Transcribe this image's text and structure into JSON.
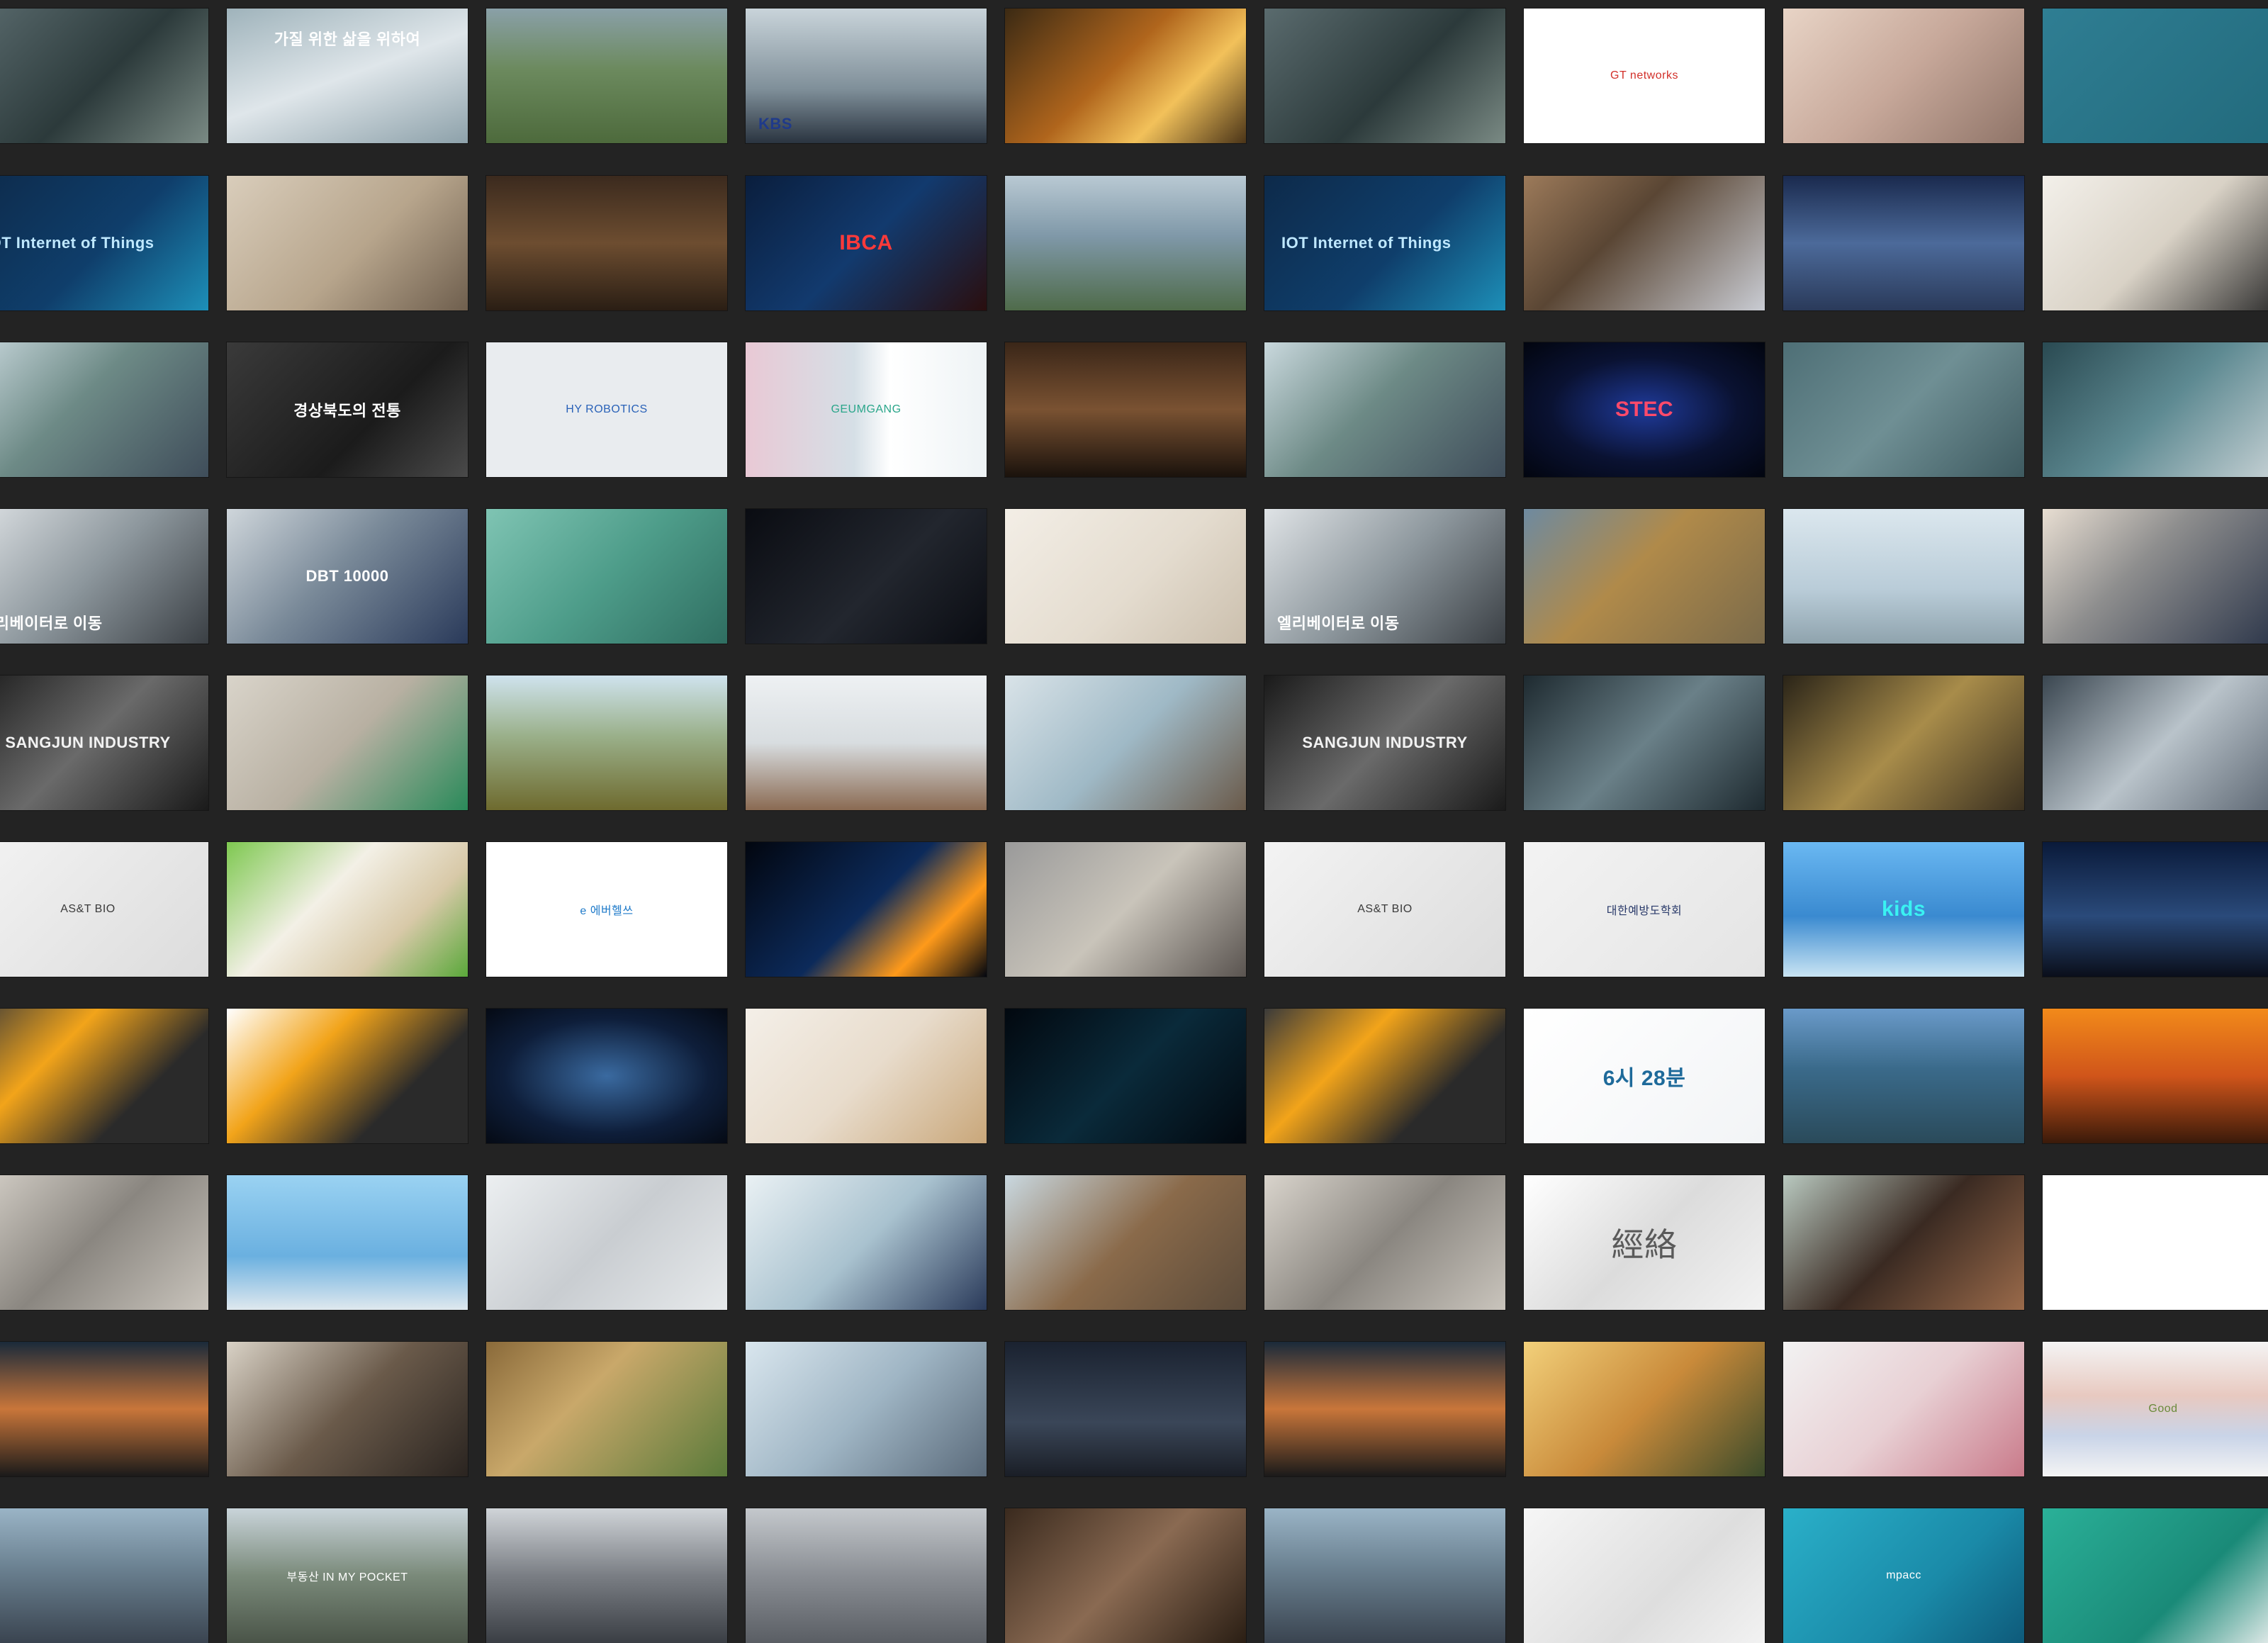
{
  "tiles": [
    {
      "bg": "linear-gradient(135deg,#5a6b6e,#2c3a3b 55%,#7a8a84)"
    },
    {
      "bg": "linear-gradient(160deg,#9fb3bb,#dfe6ea 50%,#8da1aa)",
      "caption": "가질 위한 삶을 위하여",
      "captionColor": "#ffffff",
      "style": "upper"
    },
    {
      "bg": "linear-gradient(180deg,#8aa0a8 0%,#6c8a5e 45%,#4d6a3c 100%)"
    },
    {
      "bg": "linear-gradient(180deg,#c9d4da,#7f8f99 60%,#2a3440)",
      "caption": "KBS",
      "captionColor": "#1f3a8a",
      "style": "lowerband"
    },
    {
      "bg": "linear-gradient(135deg,#3b2a14,#b0651c 45%,#f2c15a 70%,#4a3418)"
    },
    {
      "bg": "linear-gradient(135deg,#5a6b6e,#2c3a3b 55%,#7a8a84)"
    },
    {
      "bg": "#ffffff",
      "caption": "GT networks",
      "captionColor": "#d2302a",
      "style": "small"
    },
    {
      "bg": "linear-gradient(135deg,#e8d4c6,#c7a89a 50%,#8f7468)"
    },
    {
      "bg": "linear-gradient(135deg,#2f7e93,#226a7c)",
      "caption": "",
      "captionColor": "#ffffff"
    },
    {
      "bg": "linear-gradient(135deg,#0d2a4a,#0f3e6b 55%,#1d8fb8)",
      "caption": "IOT Internet of Things",
      "captionColor": "#bfe8ff",
      "style": "left"
    },
    {
      "bg": "linear-gradient(135deg,#d9cdbb,#b7a58c 55%,#6f5f4e)"
    },
    {
      "bg": "linear-gradient(180deg,#3b2a1e,#6d4d30 50%,#2a1e14)"
    },
    {
      "bg": "linear-gradient(135deg,#0a1e3d,#123a6e 50%,#2a0e0e)",
      "caption": "IBCA",
      "captionColor": "#ff3a3a",
      "style": "big"
    },
    {
      "bg": "linear-gradient(180deg,#b9c9d3,#7f98a8 45%,#4f6b4a)"
    },
    {
      "bg": "linear-gradient(135deg,#0d2a4a,#0f3e6b 55%,#1d8fb8)",
      "caption": "IOT Internet of Things",
      "captionColor": "#bfe8ff",
      "style": "left"
    },
    {
      "bg": "linear-gradient(135deg,#9c7a5a,#5a4634 40%,#c9ccd3)"
    },
    {
      "bg": "linear-gradient(180deg,#1a2a4e,#4c6a9a 50%,#2a3a5a)"
    },
    {
      "bg": "linear-gradient(135deg,#f3f0ea,#d9d2c6 50%,#2a2a2a)"
    },
    {
      "bg": "linear-gradient(135deg,#c9d8dd,#6d8a86 45%,#3f4d5a)"
    },
    {
      "bg": "linear-gradient(135deg,#3a3a3a,#1b1b1b 60%,#4a4a4a)",
      "caption": "경상북도의 전통",
      "captionColor": "#ffffff"
    },
    {
      "bg": "#e9ecef",
      "caption": "HY ROBOTICS",
      "captionColor": "#2a62b8",
      "style": "small"
    },
    {
      "bg": "linear-gradient(90deg,#e9c9d5 0%,#d5dfe6 45%,#ffffff 60%,#eef3f5 100%)",
      "caption": "GEUMGANG",
      "captionColor": "#2aa68a",
      "style": "small"
    },
    {
      "bg": "linear-gradient(180deg,#3a2618,#7a5232 50%,#1a120c)"
    },
    {
      "bg": "linear-gradient(135deg,#c9d8dd,#6d8a86 45%,#3f4d5a)"
    },
    {
      "bg": "radial-gradient(ellipse at center,#1f3a9a 0%,#0a1232 55%,#02050f 100%)",
      "caption": "STEC",
      "captionColor": "#ff4a6a",
      "style": "big"
    },
    {
      "bg": "linear-gradient(135deg,#4e6f76,#6f8f94 50%,#3e5a60)"
    },
    {
      "bg": "linear-gradient(135deg,#2a4a52,#5e8a92 50%,#c9d3d6)"
    },
    {
      "bg": "linear-gradient(135deg,#dfe3e6,#8d979d 50%,#3a3f44)",
      "caption": "엘리베이터로 이동",
      "captionColor": "#ffffff",
      "style": "lowerband"
    },
    {
      "bg": "linear-gradient(135deg,#cfd6db,#7a8a99 45%,#2a3a5a)",
      "caption": "DBT 10000",
      "captionColor": "#ffffff"
    },
    {
      "bg": "linear-gradient(135deg,#7fc4b3,#4e9d8a 50%,#2f6e61)"
    },
    {
      "bg": "linear-gradient(135deg,#0a0c12,#22262e 55%,#0a0c12)"
    },
    {
      "bg": "linear-gradient(135deg,#f3eee6,#e4dccf 55%,#cbbfad)"
    },
    {
      "bg": "linear-gradient(135deg,#dfe3e6,#8d979d 50%,#3a3f44)",
      "caption": "엘리베이터로 이동",
      "captionColor": "#ffffff",
      "style": "lowerband"
    },
    {
      "bg": "linear-gradient(135deg,#6e8aa0,#b08a4a 45%,#7a6a4a)"
    },
    {
      "bg": "linear-gradient(180deg,#dbe7ee,#b9ccd8 60%,#8fa3ad)"
    },
    {
      "bg": "linear-gradient(135deg,#e8ded2,#8e8e8e 40%,#2a3448)"
    },
    {
      "bg": "linear-gradient(135deg,#1a1a1a,#6a6a6a 50%,#1a1a1a)",
      "caption": "SANGJUN INDUSTRY",
      "captionColor": "#f2f2f2"
    },
    {
      "bg": "linear-gradient(135deg,#d9d4ca,#b8b0a2 50%,#2a8a5a)"
    },
    {
      "bg": "linear-gradient(180deg,#cfe3ee,#9ab08a 45%,#6e6a2e)"
    },
    {
      "bg": "linear-gradient(180deg,#eef1f3,#d8dde0 50%,#8a6a52)"
    },
    {
      "bg": "linear-gradient(135deg,#d9e3e8,#9fb9c6 50%,#6a5a4a)"
    },
    {
      "bg": "linear-gradient(135deg,#1a1a1a,#6a6a6a 50%,#1a1a1a)",
      "caption": "SANGJUN INDUSTRY",
      "captionColor": "#f2f2f2"
    },
    {
      "bg": "linear-gradient(135deg,#1e2a30,#6a8088 50%,#1e2a30)"
    },
    {
      "bg": "linear-gradient(135deg,#2a2418,#a88c4a 50%,#3a3020)"
    },
    {
      "bg": "linear-gradient(135deg,#3a4650,#b9c3ca 50%,#5a6470)"
    },
    {
      "bg": "linear-gradient(135deg,#f3f3f3,#dcdcdc)",
      "caption": "AS&T BIO",
      "captionColor": "#3a3a3a",
      "style": "small"
    },
    {
      "bg": "linear-gradient(135deg,#7ec850,#f3f0e6 40%,#d8c9a8 70%,#5aa83a)"
    },
    {
      "bg": "#ffffff",
      "caption": "e 에버헬쓰",
      "captionColor": "#1e7ac9",
      "style": "small"
    },
    {
      "bg": "linear-gradient(135deg,#02060f,#0c2a5a 50%,#ff9a1a 75%,#02060f)"
    },
    {
      "bg": "linear-gradient(135deg,#9a9a9a,#c9c4ba 50%,#5a5450)"
    },
    {
      "bg": "linear-gradient(135deg,#f3f3f3,#dcdcdc)",
      "caption": "AS&T BIO",
      "captionColor": "#3a3a3a",
      "style": "small"
    },
    {
      "bg": "linear-gradient(135deg,#f3f3f3,#e4e4e4)",
      "caption": "대한예방도학회",
      "captionColor": "#2a3a6a",
      "style": "small"
    },
    {
      "bg": "linear-gradient(180deg,#6ab8f2,#3a8ad0 55%,#c9e4f3)",
      "caption": "kids",
      "captionColor": "#3af2f2",
      "style": "big"
    },
    {
      "bg": "linear-gradient(180deg,#0a1a3a,#2a4a7a 55%,#0a0e1a)"
    },
    {
      "bg": "linear-gradient(135deg,#3a3a3a,#f2a41a 35%,#2a2a2a 70%)"
    },
    {
      "bg": "linear-gradient(135deg,#ffffff,#f2a41a 35%,#2a2a2a 70%)"
    },
    {
      "bg": "radial-gradient(ellipse at center,#3a6aa0 0%,#0e1e3a 60%,#050a14 100%)"
    },
    {
      "bg": "linear-gradient(135deg,#f4efe8,#e8dccc 50%,#c9a77a)"
    },
    {
      "bg": "linear-gradient(135deg,#02080f,#0a2a3a 50%,#02080f)"
    },
    {
      "bg": "linear-gradient(135deg,#3a3a3a,#f2a41a 35%,#2a2a2a 70%)"
    },
    {
      "bg": "linear-gradient(135deg,#ffffff,#f2f4f6)",
      "caption": "6시 28분",
      "captionColor": "#1e6a9a",
      "style": "big"
    },
    {
      "bg": "linear-gradient(180deg,#6a9ac9,#3a6a8a 45%,#2a4a5a)"
    },
    {
      "bg": "linear-gradient(180deg,#f28a1a,#d0551a 50%,#3a1a0a)"
    },
    {
      "bg": "linear-gradient(135deg,#d9d4cc,#8a8680 50%,#c9c4bc)"
    },
    {
      "bg": "linear-gradient(180deg,#9ad2f2,#6ab0e0 60%,#dfe8ee)"
    },
    {
      "bg": "linear-gradient(135deg,#eceff1,#c9cdd1 50%,#e6e9eb)"
    },
    {
      "bg": "linear-gradient(135deg,#eaf1f4,#a9c2cf 50%,#2a3a5a)"
    },
    {
      "bg": "linear-gradient(135deg,#c9d8e0,#8a6a4a 50%,#5a4a3a)"
    },
    {
      "bg": "linear-gradient(135deg,#d9d4cc,#8a8680 50%,#c9c4bc)"
    },
    {
      "bg": "linear-gradient(135deg,#ffffff,#dcdcdc 50%,#f2f2f2)",
      "caption": "經絡",
      "captionColor": "#5a5a5a",
      "style": "serif"
    },
    {
      "bg": "linear-gradient(135deg,#b9c9c0,#3a2a22 50%,#9a6a4a)"
    },
    {
      "bg": "#ffffff",
      "caption": "",
      "captionColor": "#2a5a2a"
    },
    {
      "bg": "linear-gradient(180deg,#1a2a3a,#c9763a 50%,#1a1a1a)"
    },
    {
      "bg": "linear-gradient(135deg,#d9d2c6,#6a5a4a 50%,#2a2420)"
    },
    {
      "bg": "linear-gradient(135deg,#8a6a3a,#c9a86a 40%,#5a7a3a)"
    },
    {
      "bg": "linear-gradient(135deg,#d9e6ee,#9fb5c4 50%,#5a6a7a)"
    },
    {
      "bg": "linear-gradient(180deg,#1a2230,#3a4658 60%,#1a1e26)"
    },
    {
      "bg": "linear-gradient(180deg,#1a2a3a,#c9763a 50%,#1a1a1a)"
    },
    {
      "bg": "linear-gradient(135deg,#f2d07a,#c98a3a 50%,#3a4a2a)"
    },
    {
      "bg": "linear-gradient(135deg,#f2f2f2,#e8d0d4 50%,#c97a8a)"
    },
    {
      "bg": "linear-gradient(180deg,#f4f4f4,#e8c9c0 40%,#c9d4e8 70%,#f4f4f4)",
      "caption": "Good",
      "captionColor": "#6a8a3a",
      "style": "small"
    },
    {
      "bg": "linear-gradient(180deg,#9ab4c6,#6a8090 45%,#3a4450)"
    },
    {
      "bg": "linear-gradient(180deg,#c9d4da,#7a8a7a 50%,#4a5448)",
      "caption": "부동산 IN MY POCKET",
      "captionColor": "#ffffff",
      "style": "small"
    },
    {
      "bg": "linear-gradient(180deg,#d0d4d8,#7a7e84 50%,#3a3e44)"
    },
    {
      "bg": "linear-gradient(180deg,#c4c8cc,#8a8e94 50%,#5a5e64)"
    },
    {
      "bg": "linear-gradient(135deg,#3a2a1e,#8a6a52 50%,#2a1e14)"
    },
    {
      "bg": "linear-gradient(180deg,#9ab4c6,#6a8090 45%,#3a4450)"
    },
    {
      "bg": "linear-gradient(135deg,#f6f6f6,#dedede 60%,#f2f2f2)"
    },
    {
      "bg": "linear-gradient(135deg,#2ab0c9,#1a8aa8 60%,#0e5a7a)",
      "caption": "mpacc",
      "captionColor": "#ffffff",
      "style": "small"
    },
    {
      "bg": "linear-gradient(135deg,#2ab098,#1a8a78 60%,#f2f2f2)"
    }
  ]
}
